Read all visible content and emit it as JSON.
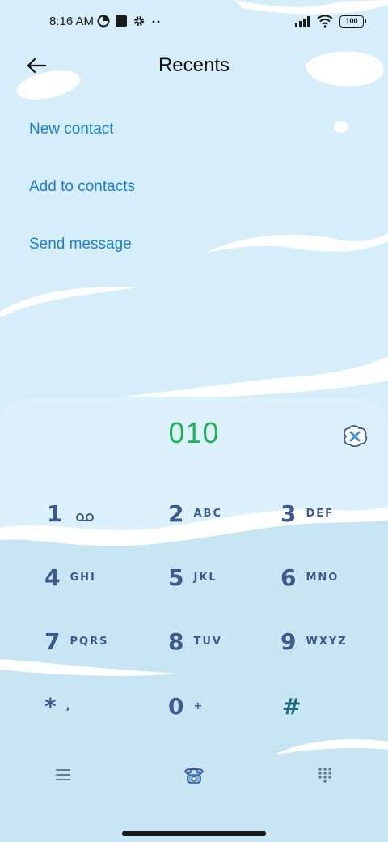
{
  "status_bar": {
    "time": "8:16 AM",
    "battery": "100"
  },
  "header": {
    "back_icon": "arrow-left-icon",
    "title": "Recents"
  },
  "actions": {
    "new_contact": "New contact",
    "add_to_contacts": "Add to contacts",
    "send_message": "Send message"
  },
  "dialer": {
    "number": "010",
    "delete_icon": "backspace-icon",
    "keys": [
      {
        "digit": "1",
        "letters": ""
      },
      {
        "digit": "2",
        "letters": "ABC"
      },
      {
        "digit": "3",
        "letters": "DEF"
      },
      {
        "digit": "4",
        "letters": "GHI"
      },
      {
        "digit": "5",
        "letters": "JKL"
      },
      {
        "digit": "6",
        "letters": "MNO"
      },
      {
        "digit": "7",
        "letters": "PQRS"
      },
      {
        "digit": "8",
        "letters": "TUV"
      },
      {
        "digit": "9",
        "letters": "WXYZ"
      },
      {
        "digit": "*",
        "letters": ","
      },
      {
        "digit": "0",
        "letters": "+"
      },
      {
        "digit": "#",
        "letters": ""
      }
    ],
    "bottom_icons": [
      "menu-icon",
      "phone-call-icon",
      "keypad-icon"
    ]
  },
  "colors": {
    "accent": "#1a7fd8",
    "number": "#1fb25a",
    "key": "#3d5a8c",
    "background": "#d6eef9"
  }
}
